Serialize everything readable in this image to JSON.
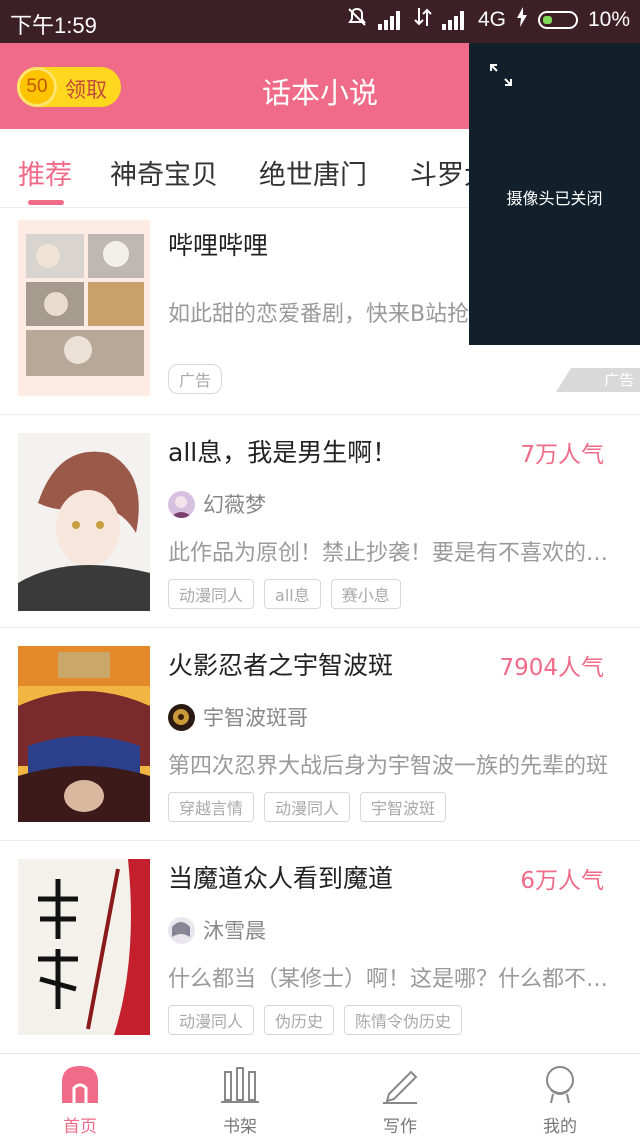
{
  "status_bar": {
    "time": "下午1:59",
    "network": "4G",
    "battery": "10%"
  },
  "header": {
    "coin_value": "50",
    "coin_label": "领取",
    "title": "话本小说"
  },
  "tabs": [
    {
      "label": "推荐",
      "active": true
    },
    {
      "label": "神奇宝贝",
      "active": false
    },
    {
      "label": "绝世唐门",
      "active": false
    },
    {
      "label": "斗罗大陆",
      "active": false
    }
  ],
  "ad_card": {
    "title": "哔哩哔哩",
    "description": "如此甜的恋爱番剧，快来B站抢先看吧",
    "tag": "广告",
    "corner_label": "广告"
  },
  "stories": [
    {
      "title": "all息，我是男生啊！",
      "popularity": "7万人气",
      "author": "幻薇梦",
      "description": "此作品为原创！禁止抄袭！要是有不喜欢的请自行离开",
      "tags": [
        "动漫同人",
        "all息",
        "赛小息"
      ]
    },
    {
      "title": "火影忍者之宇智波斑",
      "popularity": "7904人气",
      "author": "宇智波斑哥",
      "description": "第四次忍界大战后身为宇智波一族的先辈的斑",
      "tags": [
        "穿越言情",
        "动漫同人",
        "宇智波斑"
      ]
    },
    {
      "title": "当魔道众人看到魔道",
      "popularity": "6万人气",
      "author": "沐雪晨",
      "description": "什么都当（某修士）啊！这是哪？什么都不知道",
      "tags": [
        "动漫同人",
        "伪历史",
        "陈情令伪历史"
      ]
    }
  ],
  "camera_overlay": {
    "text": "摄像头已关闭"
  },
  "bottom_nav": [
    {
      "label": "首页",
      "icon": "home-icon",
      "active": true
    },
    {
      "label": "书架",
      "icon": "bookshelf-icon",
      "active": false
    },
    {
      "label": "写作",
      "icon": "pencil-icon",
      "active": false
    },
    {
      "label": "我的",
      "icon": "profile-icon",
      "active": false
    }
  ],
  "colors": {
    "brand": "#f06b88",
    "status_bar": "#3c1f27",
    "coin": "#ffd71f",
    "overlay": "#12202c"
  }
}
